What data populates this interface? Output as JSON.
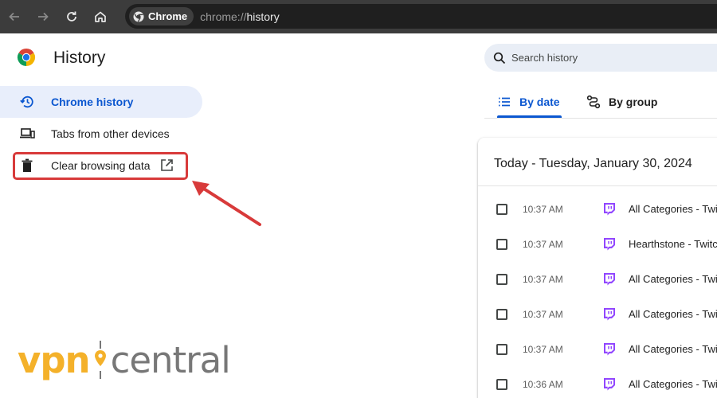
{
  "browser": {
    "tab_chip_label": "Chrome",
    "url_scheme": "chrome://",
    "url_host": "history"
  },
  "header": {
    "title": "History",
    "search_placeholder": "Search history"
  },
  "sidebar": {
    "items": [
      {
        "label": "Chrome history",
        "icon": "history-icon",
        "active": true
      },
      {
        "label": "Tabs from other devices",
        "icon": "devices-icon",
        "active": false
      },
      {
        "label": "Clear browsing data",
        "icon": "trash-icon",
        "active": false,
        "external": true
      }
    ]
  },
  "tabs": [
    {
      "label": "By date",
      "icon": "list-icon",
      "selected": true
    },
    {
      "label": "By group",
      "icon": "group-icon",
      "selected": false
    }
  ],
  "history": {
    "day_heading": "Today - Tuesday, January 30, 2024",
    "entries": [
      {
        "time": "10:37 AM",
        "title": "All Categories - Twitch",
        "favicon": "twitch-icon"
      },
      {
        "time": "10:37 AM",
        "title": "Hearthstone - Twitch",
        "favicon": "twitch-icon"
      },
      {
        "time": "10:37 AM",
        "title": "All Categories - Twitch",
        "favicon": "twitch-icon"
      },
      {
        "time": "10:37 AM",
        "title": "All Categories - Twitch",
        "favicon": "twitch-icon"
      },
      {
        "time": "10:37 AM",
        "title": "All Categories - Twitch",
        "favicon": "twitch-icon"
      },
      {
        "time": "10:36 AM",
        "title": "All Categories - Twitch",
        "favicon": "twitch-icon"
      }
    ]
  },
  "watermark": {
    "part1": "vpn",
    "part2": "central"
  },
  "colors": {
    "accent": "#0b57d0",
    "highlight": "#d83a3a",
    "twitch": "#9146ff",
    "watermark_orange": "#f4b12a"
  }
}
